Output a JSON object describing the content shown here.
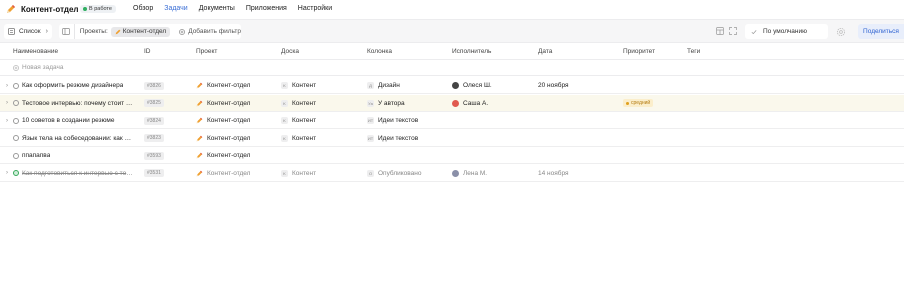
{
  "app": {
    "title": "Контент-отдел",
    "status": "В работе",
    "status_color": "#2fae5f"
  },
  "nav": [
    {
      "label": "Обзор",
      "active": false
    },
    {
      "label": "Задачи",
      "active": true
    },
    {
      "label": "Документы",
      "active": false
    },
    {
      "label": "Приложения",
      "active": false
    },
    {
      "label": "Настройки",
      "active": false
    }
  ],
  "toolbar": {
    "view_label": "Список",
    "filter_label": "Проекты:",
    "filter_chip": "Контент-отдел",
    "add_filter": "Добавить фильтр",
    "sort_label": "По умолчанию",
    "share_label": "Поделиться"
  },
  "columns": {
    "name": "Наименование",
    "id": "ID",
    "project": "Проект",
    "board": "Доска",
    "column": "Колонка",
    "assignee": "Исполнитель",
    "date": "Дата",
    "priority": "Приоритет",
    "tags": "Теги"
  },
  "new_task_label": "Новая задача",
  "tasks": [
    {
      "name": "Как оформить резюме дизайнера",
      "id": "#3826",
      "project": "Контент-отдел",
      "board_letter": "K",
      "board": "Контент",
      "column_letter": "Д",
      "column": "Дизайн",
      "assignee": "Олеся Ш.",
      "assignee_color": "#444444",
      "date": "20 ноября",
      "priority": "",
      "done": false,
      "expandable": true
    },
    {
      "name": "Тестовое интервью: почему стоит пр...",
      "id": "#3825",
      "project": "Контент-отдел",
      "board_letter": "K",
      "board": "Контент",
      "column_letter": "Уа",
      "column": "У автора",
      "assignee": "Саша А.",
      "assignee_color": "#e05a4f",
      "date": "",
      "priority": "средний",
      "done": false,
      "expandable": true
    },
    {
      "name": "10 советов в создании резюме",
      "id": "#3824",
      "project": "Контент-отдел",
      "board_letter": "K",
      "board": "Контент",
      "column_letter": "ИТ",
      "column": "Идеи текстов",
      "assignee": "",
      "assignee_color": "",
      "date": "",
      "priority": "",
      "done": false,
      "expandable": true
    },
    {
      "name": "Язык тела на собеседовании: как пр...",
      "id": "#3823",
      "project": "Контент-отдел",
      "board_letter": "K",
      "board": "Контент",
      "column_letter": "ИТ",
      "column": "Идеи текстов",
      "assignee": "",
      "assignee_color": "",
      "date": "",
      "priority": "",
      "done": false,
      "expandable": false
    },
    {
      "name": "ппапапва",
      "id": "#3593",
      "project": "Контент-отдел",
      "board_letter": "",
      "board": "",
      "column_letter": "",
      "column": "",
      "assignee": "",
      "assignee_color": "",
      "date": "",
      "priority": "",
      "done": false,
      "expandable": false
    },
    {
      "name": "Как подготовиться к интервью с топ...",
      "id": "#3531",
      "project": "Контент-отдел",
      "board_letter": "K",
      "board": "Контент",
      "column_letter": "О",
      "column": "Опубликовано",
      "assignee": "Лена М.",
      "assignee_color": "#8a8fa8",
      "date": "14 ноября",
      "priority": "",
      "done": true,
      "expandable": true
    }
  ]
}
